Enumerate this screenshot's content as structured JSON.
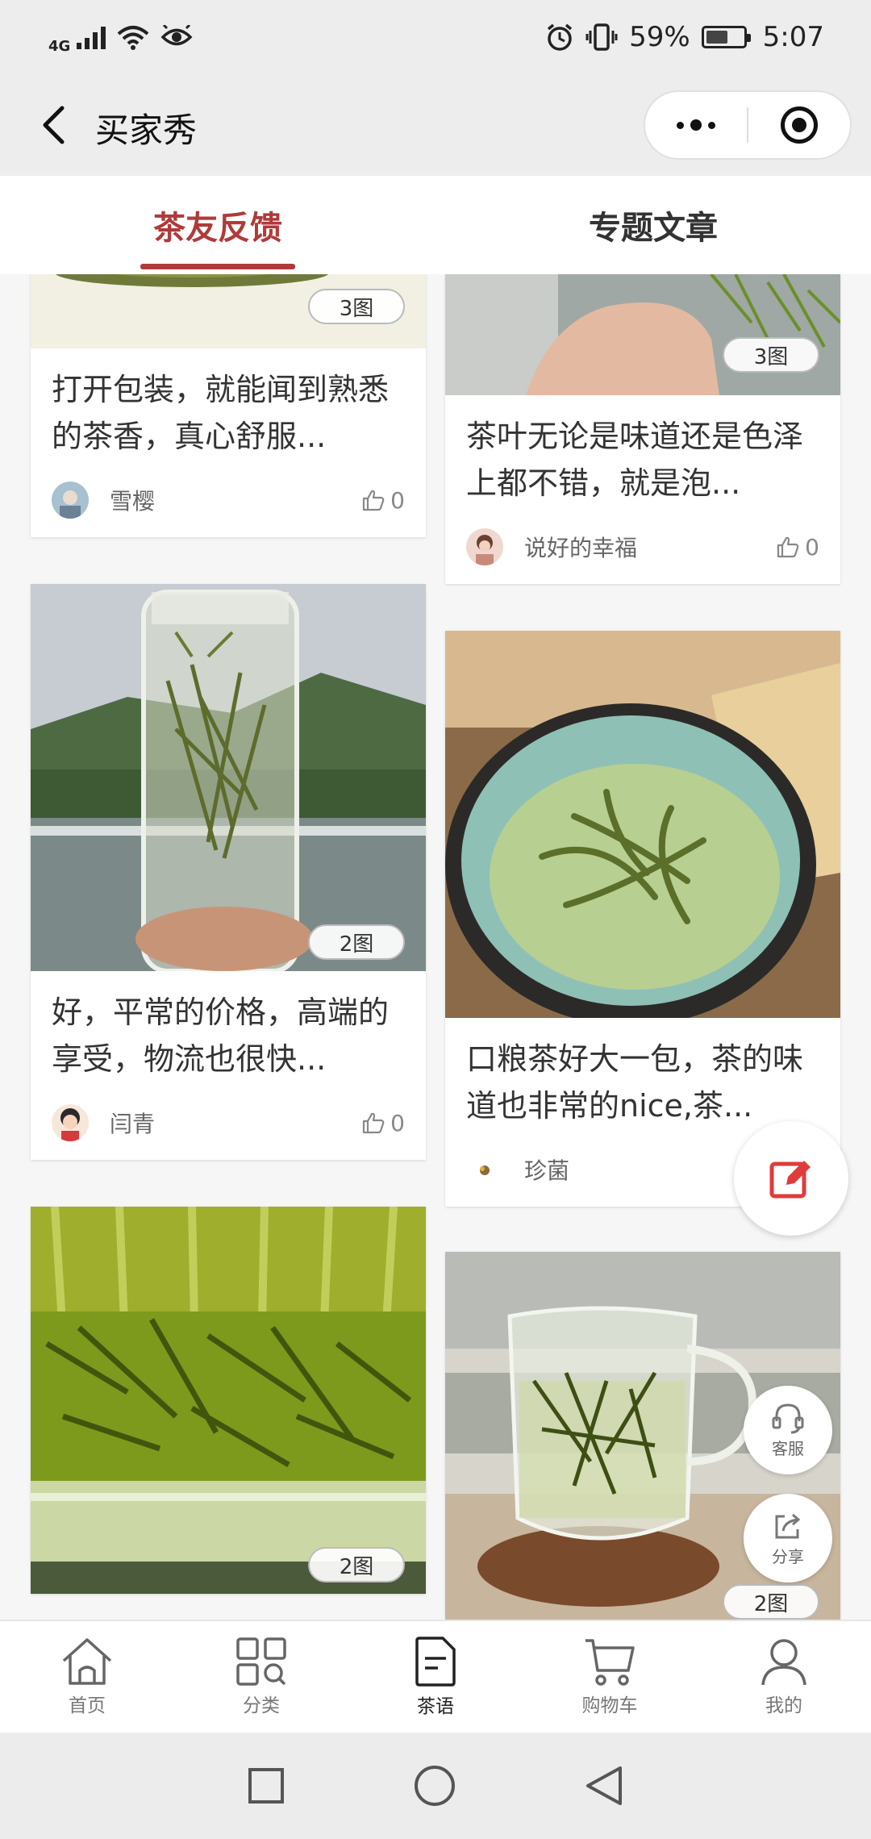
{
  "status_bar": {
    "network": "4G",
    "battery_percent": "59%",
    "battery_level": 0.59,
    "time": "5:07"
  },
  "header": {
    "title": "买家秀",
    "back_icon": "chevron-left-icon",
    "more_icon": "more-dots-icon",
    "close_icon": "target-icon"
  },
  "tabs": [
    {
      "label": "茶友反馈",
      "active": true
    },
    {
      "label": "专题文章",
      "active": false
    }
  ],
  "feed": {
    "cards": [
      {
        "text": "打开包装，就能闻到熟悉的茶香，真心舒服...",
        "image_count": "3图",
        "author": "雪樱",
        "likes": "0"
      },
      {
        "text": "茶叶无论是味道还是色泽上都不错，就是泡...",
        "image_count": "3图",
        "author": "说好的幸福",
        "likes": "0"
      },
      {
        "text": "好，平常的价格，高端的享受，物流也很快...",
        "image_count": "2图",
        "author": "闫青",
        "likes": "0"
      },
      {
        "text": "口粮茶好大一包，茶的味道也非常的nice,茶...",
        "image_count": "",
        "author": "珍菌",
        "likes": ""
      },
      {
        "text": "",
        "image_count": "2图",
        "author": "",
        "likes": ""
      },
      {
        "text": "",
        "image_count": "2图",
        "author": "",
        "likes": ""
      }
    ]
  },
  "floating": {
    "edit_icon": "edit-icon",
    "service_label": "客服",
    "share_label": "分享"
  },
  "bottom_nav": [
    {
      "label": "首页",
      "icon": "home-icon"
    },
    {
      "label": "分类",
      "icon": "category-icon"
    },
    {
      "label": "茶语",
      "icon": "document-icon",
      "active": true
    },
    {
      "label": "购物车",
      "icon": "cart-icon"
    },
    {
      "label": "我的",
      "icon": "user-icon"
    }
  ],
  "colors": {
    "accent": "#b03a3a",
    "edit": "#e03b3b"
  }
}
